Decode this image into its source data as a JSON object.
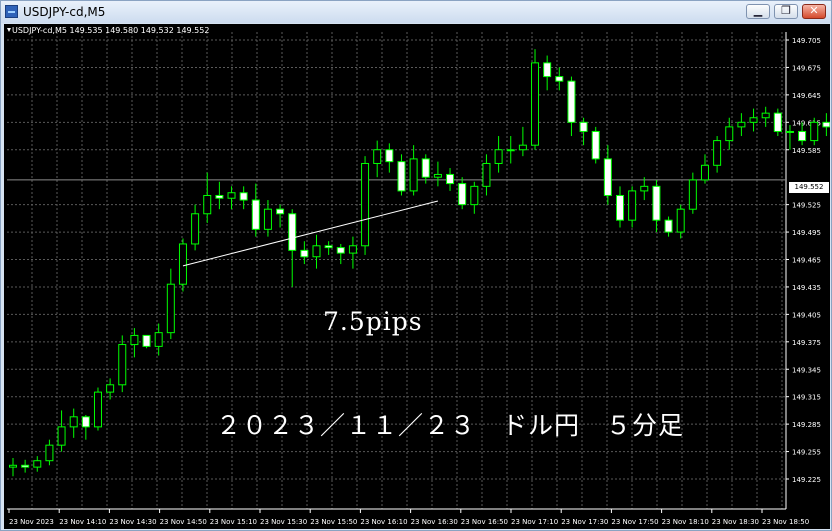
{
  "window": {
    "title": "USDJPY-cd,M5",
    "controls": {
      "minimize": "▁",
      "restore": "❐",
      "close": "✕"
    }
  },
  "chart": {
    "header": "USDJPY-cd,M5  149.535 149.580 149.532 149.552",
    "annotations": {
      "pips": "7.5pips",
      "caption": "２０２３／１１／２３　ドル円　５分足"
    },
    "current_price": "149.552"
  },
  "chart_data": {
    "type": "candlestick",
    "symbol": "USDJPY-cd",
    "timeframe": "M5",
    "ylim": [
      149.205,
      149.72
    ],
    "y_ticks": [
      "149.705",
      "149.675",
      "149.645",
      "149.615",
      "149.585",
      "149.552",
      "149.525",
      "149.495",
      "149.465",
      "149.435",
      "149.405",
      "149.375",
      "149.345",
      "149.315",
      "149.285",
      "149.255",
      "149.225"
    ],
    "x_ticks": [
      "23 Nov 2023",
      "23 Nov 14:10",
      "23 Nov 14:30",
      "23 Nov 14:50",
      "23 Nov 15:10",
      "23 Nov 15:30",
      "23 Nov 15:50",
      "23 Nov 16:10",
      "23 Nov 16:30",
      "23 Nov 16:50",
      "23 Nov 17:10",
      "23 Nov 17:30",
      "23 Nov 17:50",
      "23 Nov 18:10",
      "23 Nov 18:30",
      "23 Nov 18:50"
    ],
    "current_price": 149.552,
    "trendline": {
      "from": [
        14,
        149.458
      ],
      "to": [
        35,
        149.529
      ]
    },
    "colors": {
      "background": "#000000",
      "bull": "#000000",
      "bear": "#ffffff",
      "outline": "#00ff00",
      "grid": "#5a5a5a",
      "axis_text": "#ffffff"
    },
    "candles": [
      [
        149.238,
        149.248,
        149.228,
        149.24
      ],
      [
        149.24,
        149.246,
        149.232,
        149.238
      ],
      [
        149.238,
        149.25,
        149.233,
        149.245
      ],
      [
        149.245,
        149.268,
        149.24,
        149.262
      ],
      [
        149.262,
        149.3,
        149.255,
        149.282
      ],
      [
        149.282,
        149.302,
        149.27,
        149.293
      ],
      [
        149.293,
        149.295,
        149.268,
        149.282
      ],
      [
        149.282,
        149.325,
        149.278,
        149.32
      ],
      [
        149.32,
        149.335,
        149.312,
        149.328
      ],
      [
        149.328,
        149.382,
        149.32,
        149.372
      ],
      [
        149.372,
        149.39,
        149.358,
        149.382
      ],
      [
        149.382,
        149.38,
        149.368,
        149.37
      ],
      [
        149.37,
        149.395,
        149.36,
        149.385
      ],
      [
        149.385,
        149.455,
        149.378,
        149.438
      ],
      [
        149.438,
        149.488,
        149.43,
        149.482
      ],
      [
        149.482,
        149.525,
        149.475,
        149.515
      ],
      [
        149.515,
        149.56,
        149.505,
        149.535
      ],
      [
        149.535,
        149.55,
        149.52,
        149.532
      ],
      [
        149.532,
        149.545,
        149.52,
        149.538
      ],
      [
        149.538,
        149.545,
        149.52,
        149.53
      ],
      [
        149.53,
        149.548,
        149.49,
        149.498
      ],
      [
        149.498,
        149.53,
        149.49,
        149.52
      ],
      [
        149.52,
        149.525,
        149.5,
        149.515
      ],
      [
        149.515,
        149.52,
        149.435,
        149.475
      ],
      [
        149.475,
        149.485,
        149.46,
        149.468
      ],
      [
        149.468,
        149.492,
        149.455,
        149.48
      ],
      [
        149.48,
        149.485,
        149.47,
        149.478
      ],
      [
        149.478,
        149.482,
        149.46,
        149.472
      ],
      [
        149.472,
        149.49,
        149.455,
        149.48
      ],
      [
        149.48,
        149.578,
        149.47,
        149.57
      ],
      [
        149.57,
        149.595,
        149.555,
        149.585
      ],
      [
        149.585,
        149.592,
        149.56,
        149.572
      ],
      [
        149.572,
        149.58,
        149.535,
        149.54
      ],
      [
        149.54,
        149.59,
        149.535,
        149.575
      ],
      [
        149.575,
        149.58,
        149.548,
        149.555
      ],
      [
        149.555,
        149.572,
        149.545,
        149.558
      ],
      [
        149.558,
        149.565,
        149.54,
        149.548
      ],
      [
        149.548,
        149.555,
        149.52,
        149.525
      ],
      [
        149.525,
        149.55,
        149.515,
        149.545
      ],
      [
        149.545,
        149.58,
        149.535,
        149.57
      ],
      [
        149.57,
        149.6,
        149.56,
        149.585
      ],
      [
        149.585,
        149.6,
        149.57,
        149.585
      ],
      [
        149.585,
        149.61,
        149.578,
        149.59
      ],
      [
        149.59,
        149.695,
        149.585,
        149.68
      ],
      [
        149.68,
        149.688,
        149.65,
        149.665
      ],
      [
        149.665,
        149.675,
        149.65,
        149.66
      ],
      [
        149.66,
        149.665,
        149.6,
        149.615
      ],
      [
        149.615,
        149.62,
        149.59,
        149.605
      ],
      [
        149.605,
        149.61,
        149.57,
        149.575
      ],
      [
        149.575,
        149.59,
        149.525,
        149.535
      ],
      [
        149.535,
        149.545,
        149.5,
        149.508
      ],
      [
        149.508,
        149.545,
        149.5,
        149.54
      ],
      [
        149.54,
        149.555,
        149.53,
        149.545
      ],
      [
        149.545,
        149.552,
        149.495,
        149.508
      ],
      [
        149.508,
        149.512,
        149.49,
        149.495
      ],
      [
        149.495,
        149.525,
        149.488,
        149.52
      ],
      [
        149.52,
        149.56,
        149.515,
        149.552
      ],
      [
        149.552,
        149.58,
        149.548,
        149.568
      ],
      [
        149.568,
        149.6,
        149.56,
        149.595
      ],
      [
        149.595,
        149.62,
        149.585,
        149.61
      ],
      [
        149.61,
        149.625,
        149.6,
        149.615
      ],
      [
        149.615,
        149.63,
        149.605,
        149.62
      ],
      [
        149.62,
        149.632,
        149.61,
        149.625
      ],
      [
        149.625,
        149.63,
        149.6,
        149.605
      ],
      [
        149.605,
        149.612,
        149.585,
        149.605
      ],
      [
        149.605,
        149.615,
        149.59,
        149.595
      ],
      [
        149.595,
        149.62,
        149.59,
        149.615
      ],
      [
        149.615,
        149.625,
        149.6,
        149.61
      ],
      [
        149.61,
        149.62,
        149.585,
        149.595
      ],
      [
        149.595,
        149.605,
        149.575,
        149.58
      ]
    ]
  }
}
